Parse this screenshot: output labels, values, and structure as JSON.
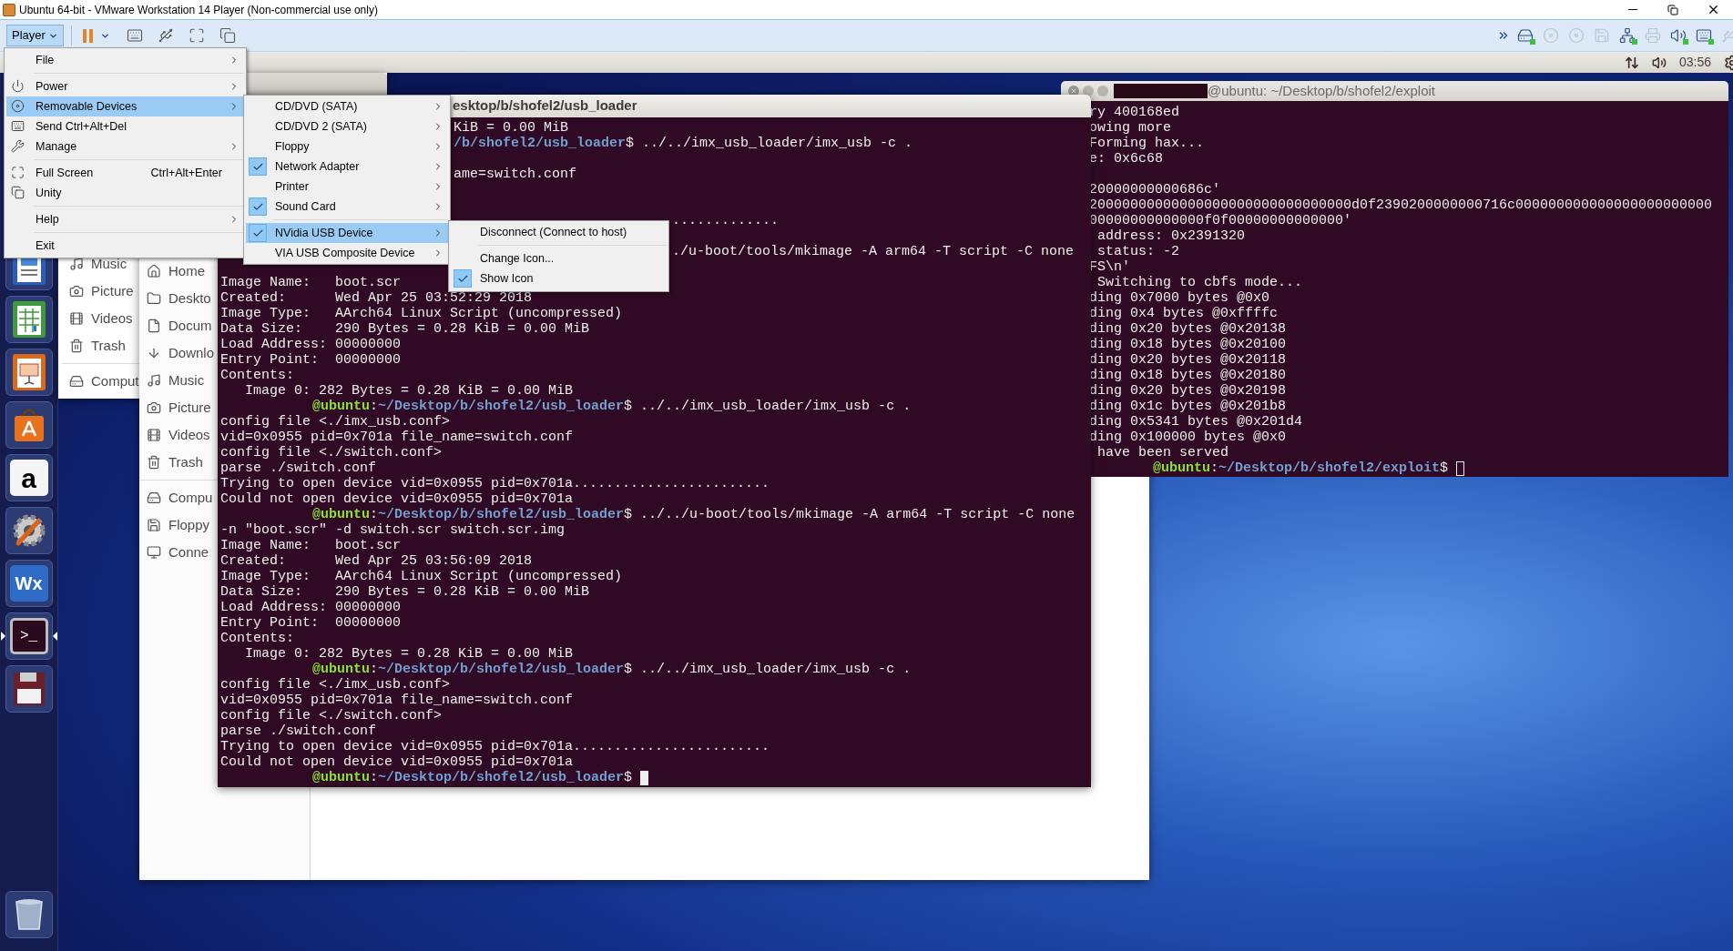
{
  "window": {
    "title": "Ubuntu 64-bit - VMware Workstation 14 Player (Non-commercial use only)"
  },
  "toolbar": {
    "player_button": {
      "label": "Player",
      "pressed": true
    }
  },
  "panel": {
    "clock": "03:56"
  },
  "player_menu": {
    "groups": [
      [
        {
          "label": "File",
          "submenu": true,
          "highlighted": false
        }
      ],
      [
        {
          "label": "Power",
          "submenu": true,
          "highlighted": false
        },
        {
          "label": "Removable Devices",
          "submenu": true,
          "highlighted": true
        },
        {
          "label": "Send Ctrl+Alt+Del",
          "submenu": false,
          "highlighted": false
        },
        {
          "label": "Manage",
          "submenu": true,
          "highlighted": false
        }
      ],
      [
        {
          "label": "Full Screen",
          "shortcut": "Ctrl+Alt+Enter",
          "submenu": false,
          "highlighted": false
        },
        {
          "label": "Unity",
          "submenu": false,
          "highlighted": false
        }
      ],
      [
        {
          "label": "Help",
          "submenu": true,
          "highlighted": false
        }
      ],
      [
        {
          "label": "Exit",
          "submenu": false,
          "highlighted": false
        }
      ]
    ]
  },
  "devices_menu": {
    "groups": [
      [
        {
          "label": "CD/DVD (SATA)",
          "checked": false,
          "submenu": true,
          "highlighted": false
        },
        {
          "label": "CD/DVD 2 (SATA)",
          "checked": false,
          "submenu": true,
          "highlighted": false
        },
        {
          "label": "Floppy",
          "checked": false,
          "submenu": true,
          "highlighted": false
        },
        {
          "label": "Network Adapter",
          "checked": true,
          "submenu": true,
          "highlighted": false
        },
        {
          "label": "Printer",
          "checked": false,
          "submenu": true,
          "highlighted": false
        },
        {
          "label": "Sound Card",
          "checked": true,
          "submenu": true,
          "highlighted": false
        }
      ],
      [
        {
          "label": "NVidia USB Device",
          "checked": true,
          "submenu": true,
          "highlighted": true
        },
        {
          "label": "VIA USB Composite Device",
          "checked": false,
          "submenu": true,
          "highlighted": false
        }
      ]
    ]
  },
  "device_menu": {
    "groups": [
      [
        {
          "label": "Disconnect (Connect to host)",
          "checked": false,
          "submenu": false,
          "highlighted": false
        }
      ],
      [
        {
          "label": "Change Icon...",
          "checked": false,
          "submenu": false,
          "highlighted": false
        },
        {
          "label": "Show Icon",
          "checked": true,
          "submenu": false,
          "highlighted": false
        }
      ]
    ]
  },
  "launcher": [
    {
      "kind": "document",
      "running": false
    },
    {
      "kind": "spreadsheet",
      "running": false
    },
    {
      "kind": "presentation",
      "running": false
    },
    {
      "kind": "store",
      "running": false
    },
    {
      "kind": "letter",
      "glyph": "a",
      "running": false
    },
    {
      "kind": "tools",
      "running": false
    },
    {
      "kind": "hex",
      "glyph": "Wx",
      "running": false
    },
    {
      "kind": "terminal",
      "glyph": ">_",
      "running": true
    },
    {
      "kind": "floppy",
      "running": false
    },
    {
      "kind": "trash",
      "running": false
    }
  ],
  "files_back": {
    "places": [
      {
        "kind": "music",
        "label": "Music"
      },
      {
        "kind": "pictures",
        "label": "Picture"
      },
      {
        "kind": "videos",
        "label": "Videos"
      },
      {
        "kind": "trash",
        "label": "Trash"
      }
    ],
    "devices": [
      {
        "kind": "computer",
        "label": "Comput"
      }
    ]
  },
  "files_front": {
    "places": [
      {
        "kind": "home",
        "label": "Home"
      },
      {
        "kind": "desktop",
        "label": "Deskto"
      },
      {
        "kind": "documents",
        "label": "Docum"
      },
      {
        "kind": "downloads",
        "label": "Downlo"
      },
      {
        "kind": "music",
        "label": "Music"
      },
      {
        "kind": "pictures",
        "label": "Picture"
      },
      {
        "kind": "videos",
        "label": "Videos"
      },
      {
        "kind": "trash",
        "label": "Trash"
      }
    ],
    "devices": [
      {
        "kind": "computer",
        "label": "Compu"
      },
      {
        "kind": "floppy",
        "label": "Floppy"
      },
      {
        "kind": "network",
        "label": "Conne"
      }
    ]
  },
  "terminal_main": {
    "title": "esktop/b/shofel2/usb_loader",
    "lines": [
      {
        "kind": "output",
        "under_menu": true,
        "text": "KiB = 0.00 MiB"
      },
      {
        "kind": "prompt",
        "under_menu": true,
        "path": "/b/shofel2/usb_loader",
        "command": "$ ../../imx_usb_loader/imx_usb -c ."
      },
      {
        "kind": "blank"
      },
      {
        "kind": "output",
        "under_menu": true,
        "text": "ame=switch.conf"
      },
      {
        "kind": "blank"
      },
      {
        "kind": "blank"
      },
      {
        "kind": "output",
        "under_submenu": true,
        "text": "............."
      },
      {
        "kind": "blank"
      },
      {
        "kind": "output",
        "under_submenu": true,
        "text": "./u-boot/tools/mkimage -A arm64 -T script -C none"
      },
      {
        "kind": "blank"
      },
      {
        "kind": "output",
        "text": "Image Name:   boot.scr"
      },
      {
        "kind": "output",
        "text": "Created:      Wed Apr 25 03:52:29 2018"
      },
      {
        "kind": "output",
        "text": "Image Type:   AArch64 Linux Script (uncompressed)"
      },
      {
        "kind": "output",
        "text": "Data Size:    290 Bytes = 0.28 KiB = 0.00 MiB"
      },
      {
        "kind": "output",
        "text": "Load Address: 00000000"
      },
      {
        "kind": "output",
        "text": "Entry Point:  00000000"
      },
      {
        "kind": "output",
        "text": "Contents:"
      },
      {
        "kind": "output",
        "text": "   Image 0: 282 Bytes = 0.28 KiB = 0.00 MiB"
      },
      {
        "kind": "prompt",
        "host": "@ubuntu",
        "sep": ":",
        "path": "~/Desktop/b/shofel2/usb_loader",
        "command": "$ ../../imx_usb_loader/imx_usb -c ."
      },
      {
        "kind": "output",
        "text": "config file <./imx_usb.conf>"
      },
      {
        "kind": "output",
        "text": "vid=0x0955 pid=0x701a file_name=switch.conf"
      },
      {
        "kind": "output",
        "text": "config file <./switch.conf>"
      },
      {
        "kind": "output",
        "text": "parse ./switch.conf"
      },
      {
        "kind": "output",
        "text": "Trying to open device vid=0x0955 pid=0x701a........................"
      },
      {
        "kind": "output",
        "text": "Could not open device vid=0x0955 pid=0x701a"
      },
      {
        "kind": "prompt",
        "host": "@ubuntu",
        "sep": ":",
        "path": "~/Desktop/b/shofel2/usb_loader",
        "command": "$ ../../u-boot/tools/mkimage -A arm64 -T script -C none"
      },
      {
        "kind": "output",
        "text": "-n \"boot.scr\" -d switch.scr switch.scr.img"
      },
      {
        "kind": "output",
        "text": "Image Name:   boot.scr"
      },
      {
        "kind": "output",
        "text": "Created:      Wed Apr 25 03:56:09 2018"
      },
      {
        "kind": "output",
        "text": "Image Type:   AArch64 Linux Script (uncompressed)"
      },
      {
        "kind": "output",
        "text": "Data Size:    290 Bytes = 0.28 KiB = 0.00 MiB"
      },
      {
        "kind": "output",
        "text": "Load Address: 00000000"
      },
      {
        "kind": "output",
        "text": "Entry Point:  00000000"
      },
      {
        "kind": "output",
        "text": "Contents:"
      },
      {
        "kind": "output",
        "text": "   Image 0: 282 Bytes = 0.28 KiB = 0.00 MiB"
      },
      {
        "kind": "prompt",
        "host": "@ubuntu",
        "sep": ":",
        "path": "~/Desktop/b/shofel2/usb_loader",
        "command": "$ ../../imx_usb_loader/imx_usb -c ."
      },
      {
        "kind": "output",
        "text": "config file <./imx_usb.conf>"
      },
      {
        "kind": "output",
        "text": "vid=0x0955 pid=0x701a file_name=switch.conf"
      },
      {
        "kind": "output",
        "text": "config file <./switch.conf>"
      },
      {
        "kind": "output",
        "text": "parse ./switch.conf"
      },
      {
        "kind": "output",
        "text": "Trying to open device vid=0x0955 pid=0x701a........................"
      },
      {
        "kind": "output",
        "text": "Could not open device vid=0x0955 pid=0x701a"
      },
      {
        "kind": "prompt",
        "host": "@ubuntu",
        "sep": ":",
        "path": "~/Desktop/b/shofel2/usb_loader",
        "command": "$",
        "cursor": {
          "filled": true
        }
      }
    ]
  },
  "terminal_exploit": {
    "title": "@ubuntu: ~/Desktop/b/shofel2/exploit",
    "lines": [
      {
        "kind": "output",
        "text": "ry 400168ed"
      },
      {
        "kind": "output",
        "text": "owing more"
      },
      {
        "kind": "output",
        "text": "Forming hax..."
      },
      {
        "kind": "output",
        "text": "e: 0x6c68"
      },
      {
        "kind": "blank"
      },
      {
        "kind": "output",
        "text": "20000000000686c'"
      },
      {
        "kind": "output",
        "text": "20000000000000000000000000000000d0f2390200000000716c000000000000000000000000"
      },
      {
        "kind": "output",
        "text": "00000000000000f0f00000000000000'"
      },
      {
        "kind": "output",
        "text": " address: 0x2391320"
      },
      {
        "kind": "output",
        "text": " status: -2"
      },
      {
        "kind": "output",
        "text": "FS\\n'"
      },
      {
        "kind": "output",
        "text": " Switching to cbfs mode..."
      },
      {
        "kind": "output",
        "text": "ding 0x7000 bytes @0x0"
      },
      {
        "kind": "output",
        "text": "ding 0x4 bytes @0xffffc"
      },
      {
        "kind": "output",
        "text": "ding 0x20 bytes @0x20138"
      },
      {
        "kind": "output",
        "text": "ding 0x18 bytes @0x20100"
      },
      {
        "kind": "output",
        "text": "ding 0x20 bytes @0x20118"
      },
      {
        "kind": "output",
        "text": "ding 0x18 bytes @0x20180"
      },
      {
        "kind": "output",
        "text": "ding 0x20 bytes @0x20198"
      },
      {
        "kind": "output",
        "text": "ding 0x1c bytes @0x201b8"
      },
      {
        "kind": "output",
        "text": "ding 0x5341 bytes @0x201d4"
      },
      {
        "kind": "output",
        "text": "ding 0x100000 bytes @0x0"
      },
      {
        "kind": "output",
        "text": " have been served"
      },
      {
        "kind": "prompt",
        "host": "@ubuntu",
        "sep": ":",
        "path": "~/Desktop/b/shofel2/exploit",
        "command": "$",
        "cursor": {
          "filled": false
        }
      }
    ]
  }
}
